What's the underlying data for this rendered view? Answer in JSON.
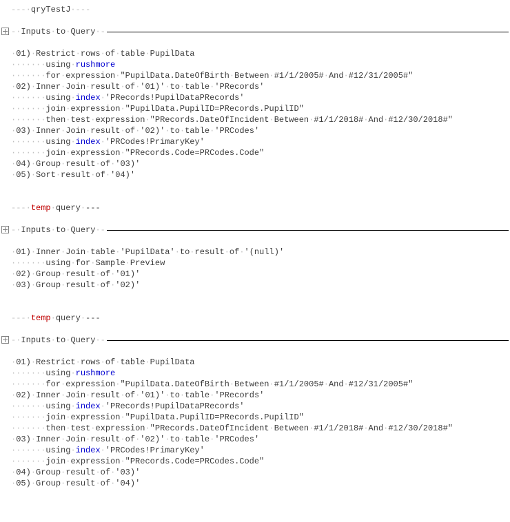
{
  "glyphs": {
    "dash": "-",
    "dot": "·"
  },
  "keywords": {
    "rushmore": "rushmore",
    "index": "index",
    "temp": "temp"
  },
  "titles": {
    "qry_test": "qryTestJ",
    "inputs": "Inputs·to·Query"
  },
  "block1": {
    "l1": "01)·Restrict·rows·of·table·PupilData",
    "l2a": "······using·",
    "l3": "······for·expression·\"PupilData.DateOfBirth·Between·#1/1/2005#·And·#12/31/2005#\"",
    "l4": "02)·Inner·Join·result·of·'01)'·to·table·'PRecords'",
    "l5a": "······using·",
    "l5b": "·'PRecords!PupilDataPRecords'",
    "l6": "······join·expression·\"PupilData.PupilID=PRecords.PupilID\"",
    "l7": "······then·test·expression·\"PRecords.DateOfIncident·Between·#1/1/2018#·And·#12/30/2018#\"",
    "l8": "03)·Inner·Join·result·of·'02)'·to·table·'PRCodes'",
    "l9a": "······using·",
    "l9b": "·'PRCodes!PrimaryKey'",
    "l10": "······join·expression·\"PRecords.Code=PRCodes.Code\"",
    "l11": "04)·Group·result·of·'03)'",
    "l12": "05)·Sort·result·of·'04)'"
  },
  "tempHeaderSuffix": "·query·---",
  "block2": {
    "l1": "01)·Inner·Join·table·'PupilData'·to·result·of·'(null)'",
    "l2": "······using·for·Sample·Preview",
    "l3": "02)·Group·result·of·'01)'",
    "l4": "03)·Group·result·of·'02)'"
  },
  "block3": {
    "l1": "01)·Restrict·rows·of·table·PupilData",
    "l2a": "······using·",
    "l3": "······for·expression·\"PupilData.DateOfBirth·Between·#1/1/2005#·And·#12/31/2005#\"",
    "l4": "02)·Inner·Join·result·of·'01)'·to·table·'PRecords'",
    "l5a": "······using·",
    "l5b": "·'PRecords!PupilDataPRecords'",
    "l6": "······join·expression·\"PupilData.PupilID=PRecords.PupilID\"",
    "l7": "······then·test·expression·\"PRecords.DateOfIncident·Between·#1/1/2018#·And·#12/30/2018#\"",
    "l8": "03)·Inner·Join·result·of·'02)'·to·table·'PRCodes'",
    "l9a": "······using·",
    "l9b": "·'PRCodes!PrimaryKey'",
    "l10": "······join·expression·\"PRecords.Code=PRCodes.Code\"",
    "l11": "04)·Group·result·of·'03)'",
    "l12": "05)·Group·result·of·'04)'"
  }
}
